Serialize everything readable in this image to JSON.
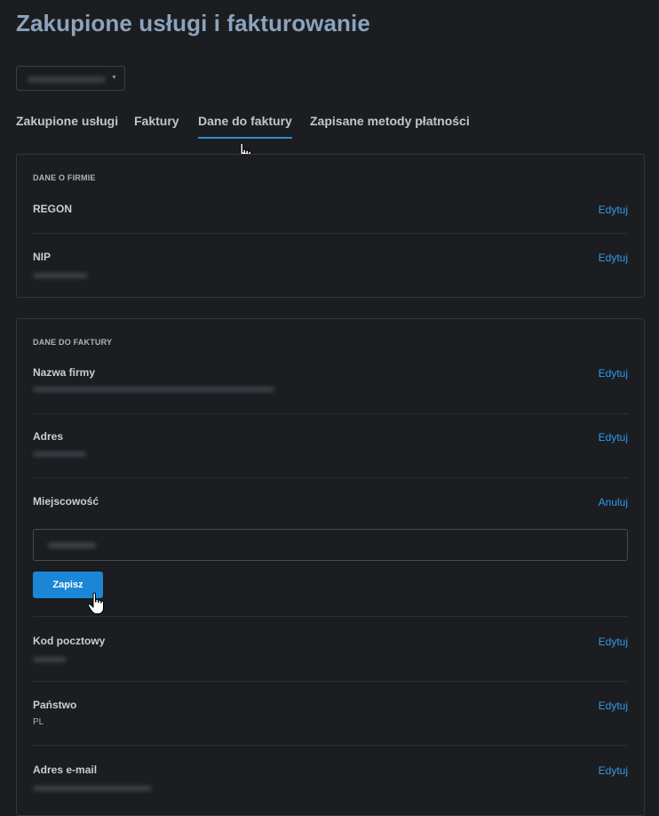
{
  "page": {
    "title": "Zakupione usługi i fakturowanie"
  },
  "account_select": {
    "value": "",
    "caret_icon": "chevron-down-icon"
  },
  "tabs": [
    {
      "label": "Zakupione usługi",
      "active": false
    },
    {
      "label": "Faktury",
      "active": false
    },
    {
      "label": "Dane do faktury",
      "active": true
    },
    {
      "label": "Zapisane metody płatności",
      "active": false
    }
  ],
  "company_section": {
    "title": "DANE O FIRMIE",
    "fields": [
      {
        "label": "REGON",
        "action": "Edytuj"
      },
      {
        "label": "NIP",
        "action": "Edytuj"
      }
    ]
  },
  "billing_section": {
    "title": "DANE DO FAKTURY",
    "fields": [
      {
        "label": "Nazwa firmy",
        "action": "Edytuj"
      },
      {
        "label": "Adres",
        "action": "Edytuj"
      },
      {
        "label": "Miejscowość",
        "action": "Anuluj",
        "editing": true
      },
      {
        "label": "Kod pocztowy",
        "action": "Edytuj"
      },
      {
        "label": "Państwo",
        "action": "Edytuj",
        "value": "PL"
      },
      {
        "label": "Adres e-mail",
        "action": "Edytuj"
      }
    ],
    "save_label": "Zapisz"
  },
  "colors": {
    "accent": "#2e9bea",
    "button": "#1b86d6",
    "title": "#8ba3bd",
    "background": "#1b1d20"
  }
}
